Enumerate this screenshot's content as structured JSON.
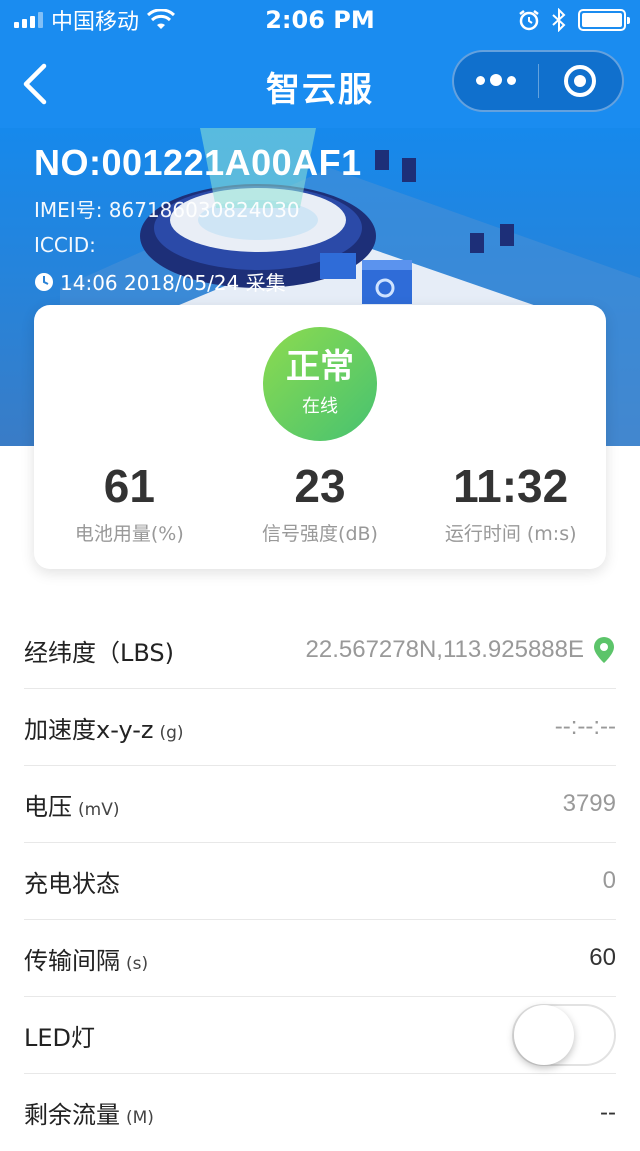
{
  "status_bar": {
    "carrier": "中国移动",
    "time": "2:06 PM"
  },
  "nav": {
    "title": "智云服"
  },
  "device": {
    "no": "NO:001221A00AF1",
    "imei_line": "IMEI号: 867186030824030",
    "iccid_line": "ICCID:",
    "collect_time": "14:06 2018/05/24 采集"
  },
  "status": {
    "main": "正常",
    "sub": "在线"
  },
  "stats": [
    {
      "value": "61",
      "label": "电池用量(%)"
    },
    {
      "value": "23",
      "label": "信号强度(dB)"
    },
    {
      "value": "11:32",
      "label": "运行时间 (m:s)"
    }
  ],
  "rows": {
    "lbs": {
      "label": "经纬度（LBS)",
      "value": "22.567278N,113.925888E"
    },
    "accel": {
      "label": "加速度x-y-z",
      "unit": "(g)",
      "value": "--:--:--"
    },
    "voltage": {
      "label": "电压",
      "unit": "(mV)",
      "value": "3799"
    },
    "charge": {
      "label": "充电状态",
      "value": "0"
    },
    "interval": {
      "label": "传输间隔",
      "unit": "(s)",
      "value": "60"
    },
    "led": {
      "label": "LED灯",
      "on": false
    },
    "traffic": {
      "label": "剩余流量",
      "unit": "(M)",
      "value": "--"
    }
  },
  "colors": {
    "primary": "#1a8cf0",
    "status_green": "#46c271",
    "pin_green": "#5cc46a"
  }
}
